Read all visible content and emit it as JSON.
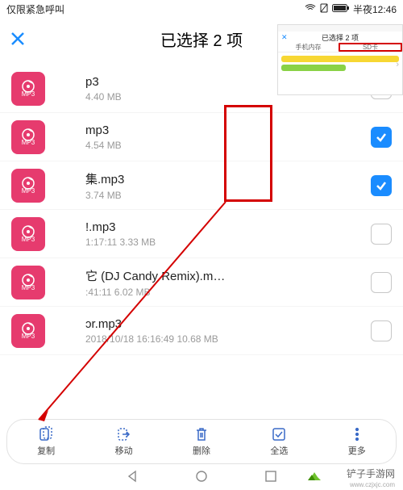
{
  "status": {
    "left": "仅限紧急呼叫",
    "time": "半夜12:46"
  },
  "header": {
    "title": "已选择 2 项"
  },
  "files": [
    {
      "name_vis": "p3",
      "meta": "4.40 MB",
      "checked": false
    },
    {
      "name_vis": "mp3",
      "meta": "4.54 MB",
      "checked": true
    },
    {
      "name_vis": "集.mp3",
      "meta": "3.74 MB",
      "checked": true
    },
    {
      "name_vis": "!.mp3",
      "meta": "1:17:11 3.33 MB",
      "checked": false
    },
    {
      "name_vis": "它 (DJ Candy Remix).m…",
      "meta": ":41:11 6.02 MB",
      "checked": false
    },
    {
      "name_vis": "ɔr.mp3",
      "meta": "2018/10/18 16:16:49 10.68 MB",
      "checked": false
    }
  ],
  "mp3_icon_label": "MP3",
  "toolbar": {
    "copy": "复制",
    "move": "移动",
    "delete": "删除",
    "select_all": "全选",
    "more": "更多"
  },
  "thumbnail": {
    "title": "已选择 2 项",
    "tab_internal": "手机内存",
    "tab_sd": "SD卡"
  },
  "watermark": {
    "brand": "铲子手游网",
    "url": "www.czjxjc.com"
  },
  "colors": {
    "accent": "#1a8cff",
    "mp3": "#e63b6e",
    "annot": "#d40000"
  }
}
